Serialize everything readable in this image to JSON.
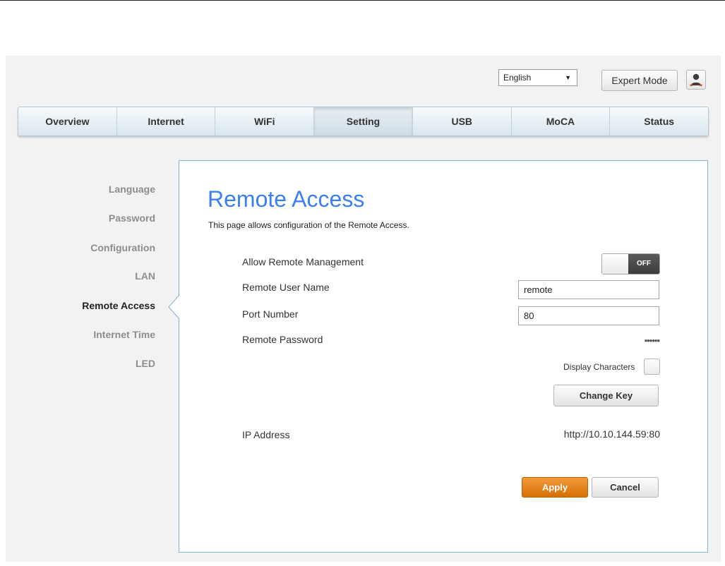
{
  "header": {
    "language": "English",
    "expert_mode": "Expert Mode",
    "user_icon": "user-icon"
  },
  "nav": {
    "tabs": [
      "Overview",
      "Internet",
      "WiFi",
      "Setting",
      "USB",
      "MoCA",
      "Status"
    ],
    "active": "Setting"
  },
  "sidebar": {
    "items": [
      "Language",
      "Password",
      "Configuration",
      "LAN",
      "Remote Access",
      "Internet Time",
      "LED"
    ],
    "active": "Remote Access"
  },
  "main": {
    "title": "Remote Access",
    "description": "This page allows configuration of the Remote Access.",
    "allow_remote_label": "Allow Remote Management",
    "allow_remote_state": "OFF",
    "username_label": "Remote User Name",
    "username_value": "remote",
    "port_label": "Port Number",
    "port_value": "80",
    "password_label": "Remote Password",
    "password_mask": "••••••",
    "display_characters": "Display Characters",
    "change_key": "Change Key",
    "ip_label": "IP Address",
    "ip_value": "http://10.10.144.59:80",
    "apply": "Apply",
    "cancel": "Cancel"
  },
  "colors": {
    "title": "#3b7ff0",
    "panel_border": "#7fb4cf",
    "apply": "#e07a12",
    "toggle_off": "#474747"
  }
}
